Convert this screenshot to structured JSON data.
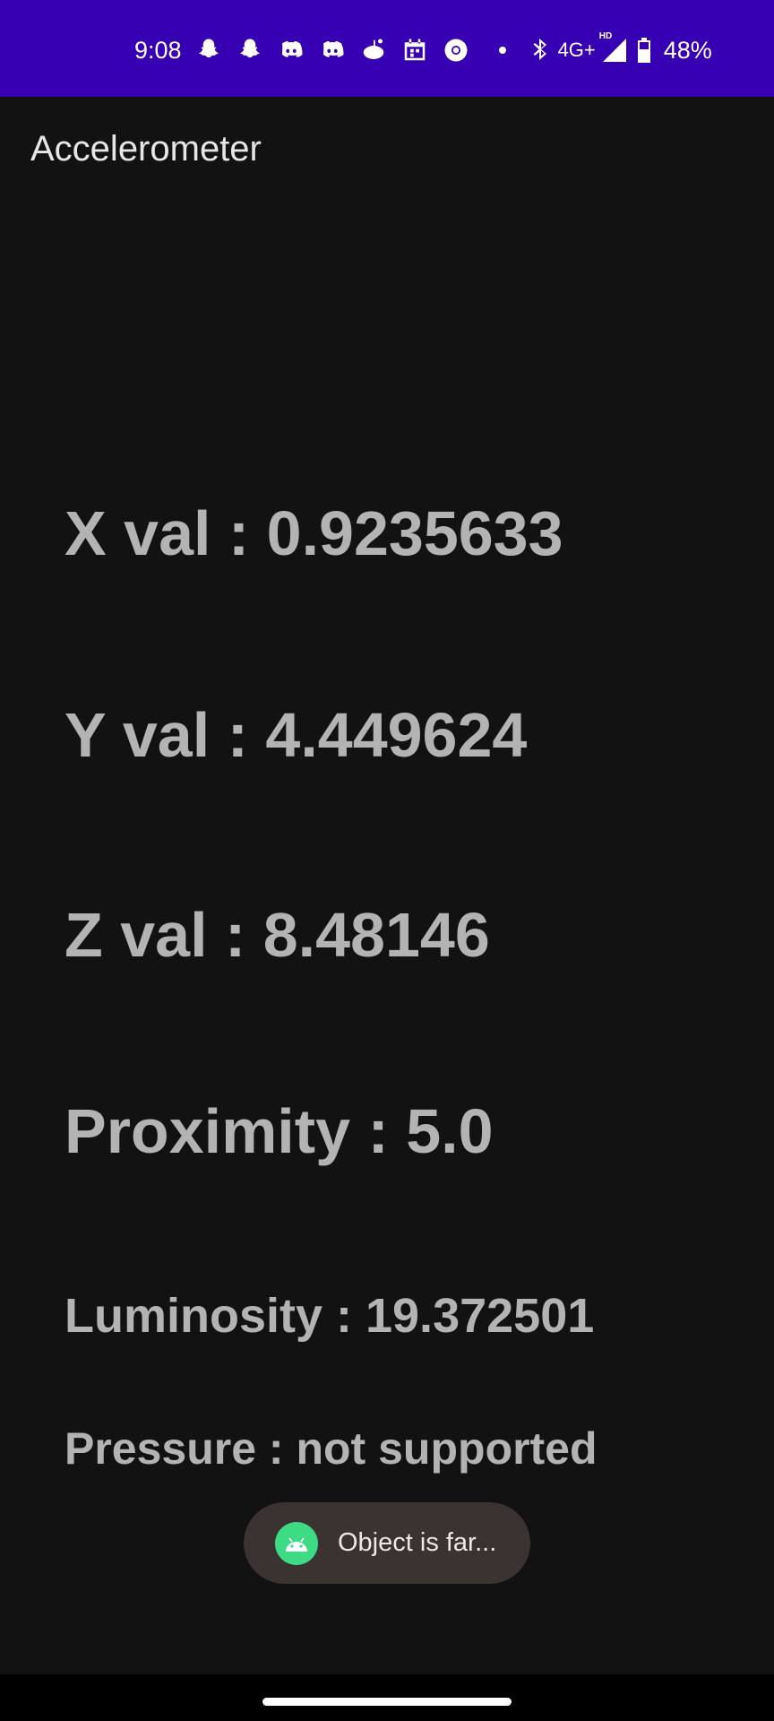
{
  "status_bar": {
    "time": "9:08",
    "network": "4G+",
    "signal_badge": "HD",
    "battery_percent": "48%",
    "notification_icons": [
      "snapchat-icon",
      "snapchat-icon",
      "discord-icon",
      "discord-icon",
      "reddit-icon",
      "calendar-icon",
      "chrome-icon"
    ],
    "system_icons": [
      "bluetooth-icon",
      "signal-icon",
      "battery-icon"
    ]
  },
  "app_bar": {
    "title": "Accelerometer"
  },
  "readings": {
    "x": "X val : 0.9235633",
    "y": "Y val : 4.449624",
    "z": "Z val : 8.48146",
    "proximity": "Proximity : 5.0",
    "luminosity": "Luminosity : 19.372501",
    "pressure": "Pressure : not supported"
  },
  "toast": {
    "message": "Object is far...",
    "icon": "android-icon"
  },
  "colors": {
    "status_bar": "#3700B3",
    "background": "#121212",
    "reading_text": "#B3B3B3",
    "toast_bg": "#3A3332",
    "android_green": "#3DDC84"
  }
}
